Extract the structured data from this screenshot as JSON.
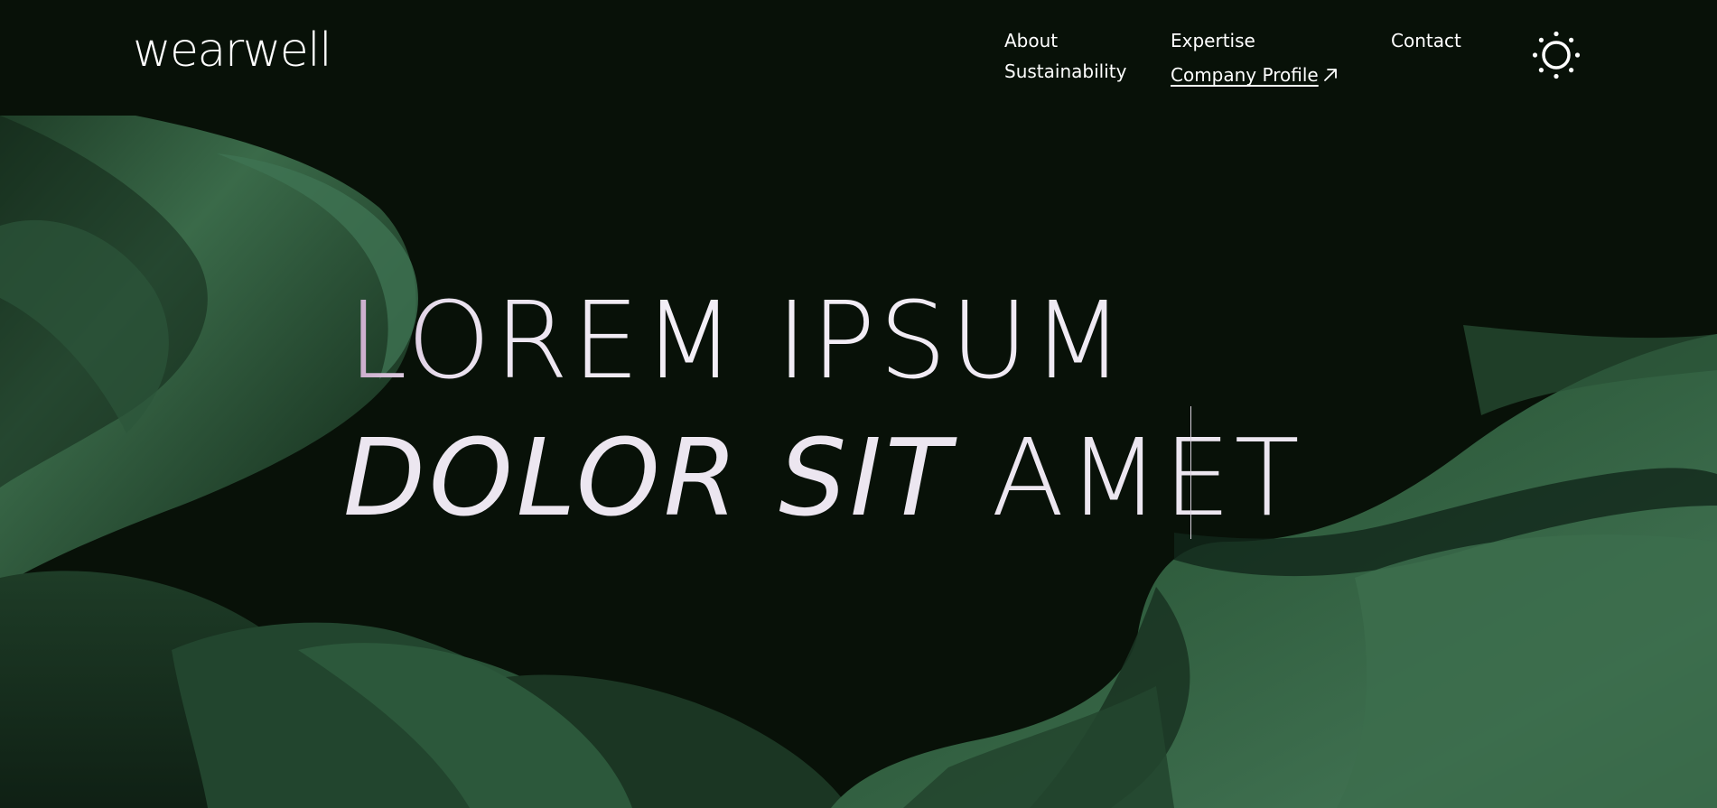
{
  "header": {
    "logo": "wearwell",
    "nav": {
      "about": "About",
      "sustainability": "Sustainability",
      "expertise": "Expertise",
      "company_profile": "Company Profile",
      "contact": "Contact"
    },
    "theme_toggle_icon": "sun-icon",
    "external_link_icon": "arrow-up-right-icon"
  },
  "hero": {
    "line1": "LOREM IPSUM",
    "line2_italic": "DOLOR SIT",
    "line2_regular": "AMET"
  },
  "colors": {
    "background": "#081108",
    "fabric_green": "#2f5a3c",
    "text": "#f3f0f5",
    "hero_gradient_start": "#c9a7c9"
  }
}
